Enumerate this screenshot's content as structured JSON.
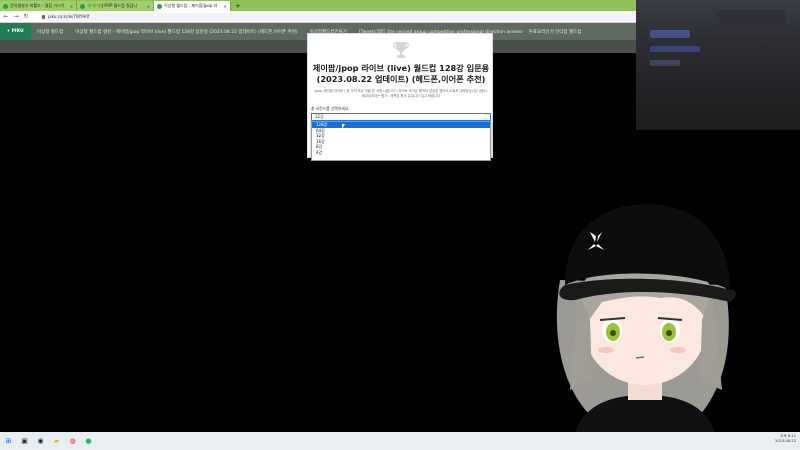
{
  "browser": {
    "tabs": [
      {
        "title": "전치결실기 비틀즈 - 결합 거시기"
      },
      {
        "title": "💚💚💚J-POP 월드컵 질겁니"
      },
      {
        "title": "이상형 월드컵 - 제이팝/jpop 라"
      }
    ],
    "active_tab": 2,
    "url": "piku.co.kr/w/7WYH0f",
    "new_tab": "+"
  },
  "site": {
    "logo": "PIKU",
    "nav": [
      "이상형 월드컵",
      "이상형 월드컵 랭킹 - 제이팝/jpop 라이브 (live) 월드컵 128강 입문용 (2023.08.22 업데이트) (헤드폰,이어폰 추천)",
      "이상형월드컵만들기",
      "[Tweets]레드 the second group competition professional direction assessment performance",
      "투표요리인기 인디업 월드컵"
    ]
  },
  "modal": {
    "title_line1": "제이팝/jpop 라이브 (live) 월드컵 128강 입문용",
    "title_line2": "(2023.08.22 업데이트) (헤드폰,이어폰 추천)",
    "description": "jpop, 제이팝 라이브 ) 한 가지 곡은 곡을 한 곡씩 나옵니다 ) 라이브 추석은 원곡의 감성은 영어서 오로지 대체영상니다 (음소) 레코딩과자는 평가 : 제목은 원곡 유입니다 입고 바랍니다",
    "round_label": "총 라운드를 선택하세요.",
    "select_value": "32강",
    "options": [
      "128강",
      "64강",
      "32강",
      "16강",
      "8강",
      "4강"
    ],
    "selected_option": 0
  },
  "taskbar": {
    "clock_line1": "오후 8:11",
    "clock_line2": "2023-08-22"
  },
  "colors": {
    "tabbar": "#8fc05a",
    "site_nav": "#5f6a60",
    "logo_bg": "#1f7e58",
    "select_highlight": "#1a6ed8",
    "page_background": "#000000"
  }
}
